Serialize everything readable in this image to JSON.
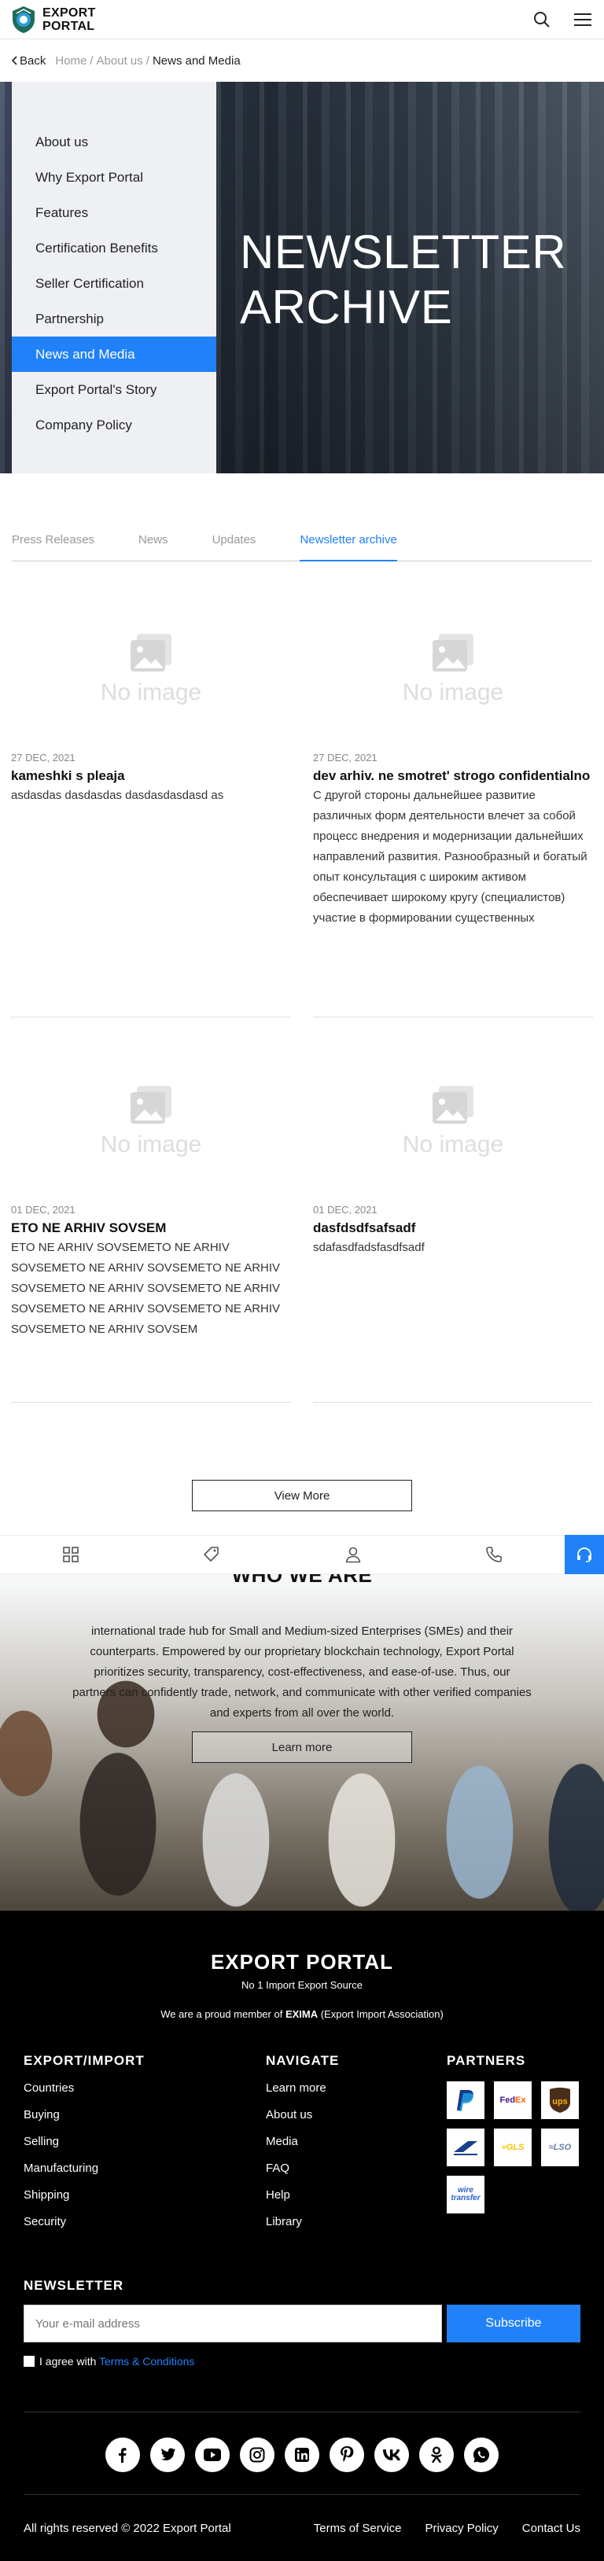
{
  "header": {
    "brand_line1": "EXPORT",
    "brand_line2": "PORTAL"
  },
  "breadcrumb": {
    "back": "Back",
    "items": [
      "Home",
      "About us",
      "News and Media"
    ]
  },
  "sidebar": {
    "items": [
      {
        "label": "About us"
      },
      {
        "label": "Why Export Portal"
      },
      {
        "label": "Features"
      },
      {
        "label": "Certification Benefits"
      },
      {
        "label": "Seller Certification"
      },
      {
        "label": "Partnership"
      },
      {
        "label": "News and Media"
      },
      {
        "label": "Export Portal's Story"
      },
      {
        "label": "Company Policy"
      }
    ],
    "active": "News and Media"
  },
  "hero": {
    "title_line1": "NEWSLETTER",
    "title_line2": "ARCHIVE"
  },
  "tabs": {
    "items": [
      "Press Releases",
      "News",
      "Updates",
      "Newsletter archive"
    ],
    "active": "Newsletter archive"
  },
  "no_image_text": "No image",
  "articles": [
    {
      "date": "27 DEC, 2021",
      "title": "kameshki s pleaja",
      "text": "asdasdas dasdasdas dasdasdasdasd as"
    },
    {
      "date": "27 DEC, 2021",
      "title": "dev arhiv. ne smotret' strogo confidentialno",
      "text": "С другой стороны дальнейшее развитие различных форм деятельности влечет за собой процесс внедрения и модернизации дальнейших направлений развития. Разнообразный и богатый опыт консультация с широким активом обеспечивает широкому кругу (специалистов) участие в формировании существенных"
    },
    {
      "date": "01 DEC, 2021",
      "title": "ETO NE ARHIV SOVSEM",
      "text": "ETO NE ARHIV SOVSEMETO NE ARHIV SOVSEMETO NE ARHIV SOVSEMETO NE ARHIV SOVSEMETO NE ARHIV SOVSEMETO NE ARHIV SOVSEMETO NE ARHIV SOVSEMETO NE ARHIV SOVSEMETO NE ARHIV SOVSEM"
    },
    {
      "date": "01 DEC, 2021",
      "title": "dasfdsdfsafsadf",
      "text": "sdafasdfadsfasdfsadf"
    }
  ],
  "view_more": "View More",
  "who": {
    "title": "WHO WE ARE",
    "blurb": "international trade hub for Small and Medium-sized Enterprises (SMEs) and their counterparts. Empowered by our proprietary blockchain technology, Export Portal prioritizes security, transparency, cost-effectiveness, and ease-of-use. Thus, our partners can confidently trade, network, and communicate with other verified companies and experts from all over the world.",
    "button": "Learn more"
  },
  "bottom_bar": {
    "icons": [
      "grid-icon",
      "tag-icon",
      "user-icon",
      "phone-icon",
      "headset-icon"
    ]
  },
  "footer": {
    "brand": "EXPORT PORTAL",
    "tagline": "No 1 Import Export Source",
    "membership_prefix": "We are a proud member of ",
    "membership_org": "EXIMA",
    "membership_suffix": " (Export Import Association)",
    "col1": {
      "title": "EXPORT/IMPORT",
      "links": [
        "Countries",
        "Buying",
        "Selling",
        "Manufacturing",
        "Shipping",
        "Security"
      ]
    },
    "col2": {
      "title": "NAVIGATE",
      "links": [
        "Learn more",
        "About us",
        "Media",
        "FAQ",
        "Help",
        "Library"
      ]
    },
    "col3": {
      "title": "PARTNERS",
      "partners": [
        "PayPal",
        "FedEx",
        "UPS",
        "USPS",
        "GLS",
        "LSO",
        "wire transfer"
      ]
    },
    "newsletter": {
      "title": "NEWSLETTER",
      "placeholder": "Your e-mail address",
      "button": "Subscribe",
      "agree_prefix": "I agree with ",
      "agree_link": "Terms & Conditions"
    },
    "socials": [
      "facebook-icon",
      "twitter-icon",
      "youtube-icon",
      "instagram-icon",
      "linkedin-icon",
      "pinterest-icon",
      "vk-icon",
      "odnoklassniki-icon",
      "whatsapp-icon"
    ],
    "copyright": "All rights reserved © 2022 Export Portal",
    "legal_links": [
      "Terms of Service",
      "Privacy Policy",
      "Contact Us"
    ]
  },
  "colors": {
    "accent": "#2181f8",
    "footer_bg": "#000000"
  }
}
